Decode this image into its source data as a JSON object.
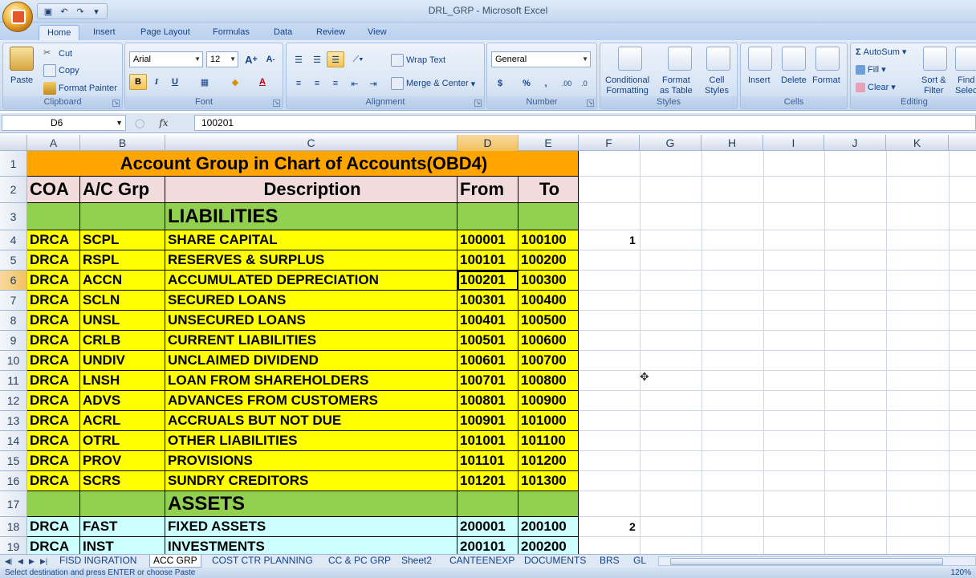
{
  "window": {
    "title": "DRL_GRP - Microsoft Excel"
  },
  "tabs": [
    "Home",
    "Insert",
    "Page Layout",
    "Formulas",
    "Data",
    "Review",
    "View"
  ],
  "ribbon": {
    "clipboard": {
      "paste": "Paste",
      "cut": "Cut",
      "copy": "Copy",
      "format_painter": "Format Painter",
      "label": "Clipboard"
    },
    "font": {
      "name": "Arial",
      "size": "12",
      "bold": "B",
      "italic": "I",
      "underline": "U",
      "label": "Font"
    },
    "alignment": {
      "wrap": "Wrap Text",
      "merge": "Merge & Center",
      "label": "Alignment"
    },
    "number": {
      "format": "General",
      "currency": "$",
      "percent": "%",
      "comma": ",",
      "label": "Number"
    },
    "styles": {
      "conditional_1": "Conditional",
      "conditional_2": "Formatting",
      "format_table_1": "Format",
      "format_table_2": "as Table",
      "cell_styles_1": "Cell",
      "cell_styles_2": "Styles",
      "label": "Styles"
    },
    "cells": {
      "insert": "Insert",
      "delete": "Delete",
      "format": "Format",
      "label": "Cells"
    },
    "editing": {
      "autosum": "AutoSum",
      "fill": "Fill",
      "clear": "Clear",
      "sort_1": "Sort &",
      "sort_2": "Filter",
      "find_1": "Find",
      "find_2": "Selec",
      "label": "Editing"
    }
  },
  "formula_bar": {
    "name_box": "D6",
    "fx": "fx",
    "content": "100201"
  },
  "columns": [
    "A",
    "B",
    "C",
    "D",
    "E",
    "F",
    "G",
    "H",
    "I",
    "J",
    "K"
  ],
  "rows": [
    "1",
    "2",
    "3",
    "4",
    "5",
    "6",
    "7",
    "8",
    "9",
    "10",
    "11",
    "12",
    "13",
    "14",
    "15",
    "16",
    "17",
    "18",
    "19"
  ],
  "sheet": {
    "title": "Account Group in Chart of Accounts(OBD4)",
    "headers": {
      "coa": "COA",
      "grp": "A/C Grp",
      "desc": "Description",
      "from": "From",
      "to": "To"
    },
    "section_liabilities": "LIABILITIES",
    "section_assets": "ASSETS",
    "liabilities": [
      {
        "coa": "DRCA",
        "grp": "SCPL",
        "desc": "SHARE CAPITAL",
        "from": "100001",
        "to": "100100"
      },
      {
        "coa": "DRCA",
        "grp": "RSPL",
        "desc": "RESERVES & SURPLUS",
        "from": "100101",
        "to": "100200"
      },
      {
        "coa": "DRCA",
        "grp": "ACCN",
        "desc": "ACCUMULATED DEPRECIATION",
        "from": "100201",
        "to": "100300"
      },
      {
        "coa": "DRCA",
        "grp": "SCLN",
        "desc": "SECURED LOANS",
        "from": "100301",
        "to": "100400"
      },
      {
        "coa": "DRCA",
        "grp": "UNSL",
        "desc": "UNSECURED LOANS",
        "from": "100401",
        "to": "100500"
      },
      {
        "coa": "DRCA",
        "grp": "CRLB",
        "desc": "CURRENT LIABILITIES",
        "from": "100501",
        "to": "100600"
      },
      {
        "coa": "DRCA",
        "grp": "UNDIV",
        "desc": "UNCLAIMED DIVIDEND",
        "from": "100601",
        "to": "100700"
      },
      {
        "coa": "DRCA",
        "grp": "LNSH",
        "desc": "LOAN FROM SHAREHOLDERS",
        "from": "100701",
        "to": "100800"
      },
      {
        "coa": "DRCA",
        "grp": "ADVS",
        "desc": "ADVANCES FROM CUSTOMERS",
        "from": "100801",
        "to": "100900"
      },
      {
        "coa": "DRCA",
        "grp": "ACRL",
        "desc": "ACCRUALS BUT NOT DUE",
        "from": "100901",
        "to": "101000"
      },
      {
        "coa": "DRCA",
        "grp": "OTRL",
        "desc": "OTHER LIABILITIES",
        "from": "101001",
        "to": "101100"
      },
      {
        "coa": "DRCA",
        "grp": "PROV",
        "desc": "PROVISIONS",
        "from": "101101",
        "to": "101200"
      },
      {
        "coa": "DRCA",
        "grp": "SCRS",
        "desc": "SUNDRY CREDITORS",
        "from": "101201",
        "to": "101300"
      }
    ],
    "assets": [
      {
        "coa": "DRCA",
        "grp": "FAST",
        "desc": "FIXED ASSETS",
        "from": "200001",
        "to": "200100"
      },
      {
        "coa": "DRCA",
        "grp": "INST",
        "desc": "INVESTMENTS",
        "from": "200101",
        "to": "200200"
      }
    ],
    "f4": "1",
    "f18": "2"
  },
  "sheet_tabs": [
    "FISD INGRATION",
    "ACC GRP",
    "COST CTR PLANNING",
    "CC & PC GRP",
    "Sheet2",
    "CANTEENEXP",
    "DOCUMENTS",
    "BRS",
    "GL"
  ],
  "status": {
    "message": "Select destination and press ENTER or choose Paste",
    "zoom": "120%"
  },
  "colors": {
    "header_orange": "#ffa500",
    "header_pink": "#f2dcdb",
    "section_green": "#92d050",
    "liab_yellow": "#ffff00",
    "asset_cyan": "#ccffff",
    "selection": "#f1c15f"
  }
}
